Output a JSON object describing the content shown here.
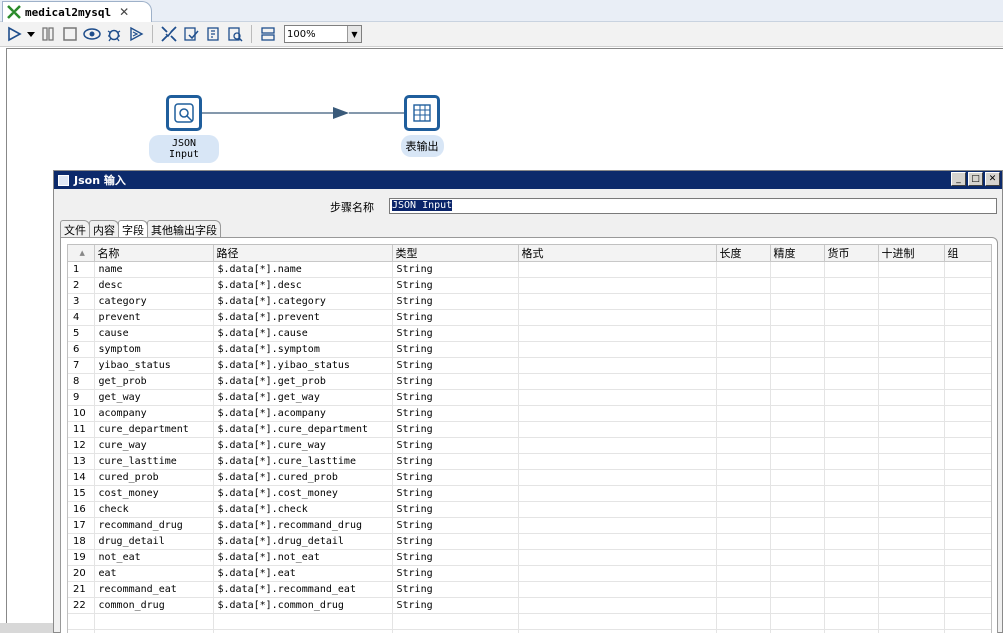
{
  "tab": {
    "title": "medical2mysql",
    "close": "✕"
  },
  "toolbar": {
    "zoom": "100%"
  },
  "canvas": {
    "nodes": [
      {
        "label": "JSON Input"
      },
      {
        "label": "表输出"
      }
    ]
  },
  "dialog": {
    "title": "Json 输入",
    "step_name_label": "步骤名称",
    "step_name_value": "JSON Input",
    "tabs": [
      "文件",
      "内容",
      "字段",
      "其他输出字段"
    ],
    "active_tab": "字段",
    "columns": [
      "",
      "名称",
      "路径",
      "类型",
      "格式",
      "长度",
      "精度",
      "货币",
      "十进制",
      "组"
    ],
    "rows": [
      {
        "n": "1",
        "name": "name",
        "path": "$.data[*].name",
        "type": "String"
      },
      {
        "n": "2",
        "name": "desc",
        "path": "$.data[*].desc",
        "type": "String"
      },
      {
        "n": "3",
        "name": "category",
        "path": "$.data[*].category",
        "type": "String"
      },
      {
        "n": "4",
        "name": "prevent",
        "path": "$.data[*].prevent",
        "type": "String"
      },
      {
        "n": "5",
        "name": "cause",
        "path": "$.data[*].cause",
        "type": "String"
      },
      {
        "n": "6",
        "name": "symptom",
        "path": "$.data[*].symptom",
        "type": "String"
      },
      {
        "n": "7",
        "name": "yibao_status",
        "path": "$.data[*].yibao_status",
        "type": "String"
      },
      {
        "n": "8",
        "name": "get_prob",
        "path": "$.data[*].get_prob",
        "type": "String"
      },
      {
        "n": "9",
        "name": "get_way",
        "path": "$.data[*].get_way",
        "type": "String"
      },
      {
        "n": "10",
        "name": "acompany",
        "path": "$.data[*].acompany",
        "type": "String"
      },
      {
        "n": "11",
        "name": "cure_department",
        "path": "$.data[*].cure_department",
        "type": "String"
      },
      {
        "n": "12",
        "name": "cure_way",
        "path": "$.data[*].cure_way",
        "type": "String"
      },
      {
        "n": "13",
        "name": "cure_lasttime",
        "path": "$.data[*].cure_lasttime",
        "type": "String"
      },
      {
        "n": "14",
        "name": "cured_prob",
        "path": "$.data[*].cured_prob",
        "type": "String"
      },
      {
        "n": "15",
        "name": "cost_money",
        "path": "$.data[*].cost_money",
        "type": "String"
      },
      {
        "n": "16",
        "name": "check",
        "path": "$.data[*].check",
        "type": "String"
      },
      {
        "n": "17",
        "name": "recommand_drug",
        "path": "$.data[*].recommand_drug",
        "type": "String"
      },
      {
        "n": "18",
        "name": "drug_detail",
        "path": "$.data[*].drug_detail",
        "type": "String"
      },
      {
        "n": "19",
        "name": "not_eat",
        "path": "$.data[*].not_eat",
        "type": "String"
      },
      {
        "n": "20",
        "name": "eat",
        "path": "$.data[*].eat",
        "type": "String"
      },
      {
        "n": "21",
        "name": "recommand_eat",
        "path": "$.data[*].recommand_eat",
        "type": "String"
      },
      {
        "n": "22",
        "name": "common_drug",
        "path": "$.data[*].common_drug",
        "type": "String"
      }
    ]
  },
  "colors": {
    "title_bar": "#0c2a6b",
    "node_border": "#1f5e9c",
    "node_label_bg": "#d8e6f6"
  }
}
